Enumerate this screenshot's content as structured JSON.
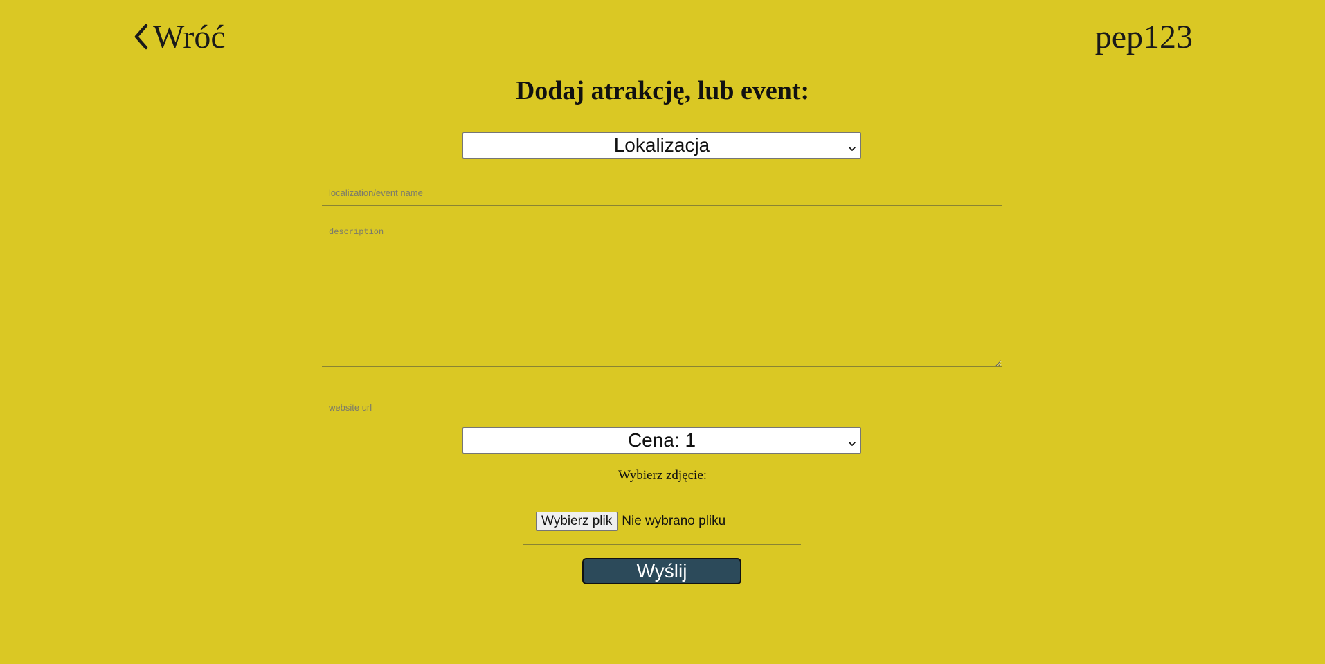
{
  "header": {
    "back_label": "Wróć",
    "username": "pep123"
  },
  "form": {
    "title": "Dodaj atrakcję, lub event:",
    "type_select": {
      "selected": "Lokalizacja"
    },
    "name_input": {
      "placeholder": "localization/event name",
      "value": ""
    },
    "description": {
      "placeholder": "description",
      "value": ""
    },
    "url_input": {
      "placeholder": "website url",
      "value": ""
    },
    "price_select": {
      "selected": "Cena: 1"
    },
    "photo_label": "Wybierz zdjęcie:",
    "file_button_label": "Wybierz plik",
    "file_status": "Nie wybrano pliku",
    "submit_label": "Wyślij"
  },
  "colors": {
    "background": "#dac824",
    "submit_bg": "#2c4a5a",
    "text": "#111111"
  },
  "icons": {
    "back": "chevron-left-icon",
    "select": "chevron-down-icon",
    "textarea": "resize-grip-icon"
  }
}
